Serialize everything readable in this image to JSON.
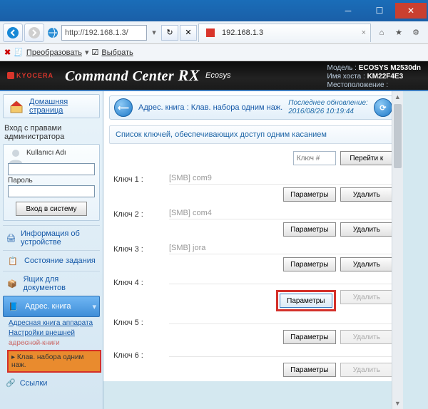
{
  "window": {
    "url": "http://192.168.1.3/",
    "tab_title": "192.168.1.3"
  },
  "linkbar": {
    "convert": "Преобразовать",
    "select": "Выбрать"
  },
  "header": {
    "brand_small": "KYOCERA",
    "title": "Command Center",
    "title_rx": "RX",
    "ecosys": "Ecosys",
    "model_lbl": "Модель :",
    "model": "ECOSYS M2530dn",
    "host_lbl": "Имя хоста :",
    "host": "KM22F4E3",
    "loc_lbl": "Местоположение :",
    "loc": ""
  },
  "sidebar": {
    "home": "Домашняя страница",
    "admin_head": "Вход с правами администратора",
    "user_lbl": "Kullanıcı Adı",
    "pass_lbl": "Пароль",
    "login_btn": "Вход в систему",
    "items": [
      "Информация об устройстве",
      "Состояние задания",
      "Ящик для документов",
      "Адрес. книга"
    ],
    "sub": {
      "a": "Адресная книга аппарата",
      "b": "Настройки внешней",
      "b2": "адресной книги",
      "current": "Клав. набора одним наж."
    },
    "refs": "Ссылки"
  },
  "crumb": {
    "text": "Адрес. книга : Клав. набора одним наж.",
    "upd1": "Последнее обновление:",
    "upd2": "2016/08/26 10:19:44"
  },
  "main": {
    "section": "Список ключей, обеспечивающих доступ одним касанием",
    "key_placeholder": "Ключ #",
    "goto": "Перейти к",
    "key_lbl": "Ключ",
    "params": "Параметры",
    "delete": "Удалить",
    "rows": [
      {
        "n": "1",
        "val": "[SMB] com9",
        "del": true
      },
      {
        "n": "2",
        "val": "[SMB] com4",
        "del": true
      },
      {
        "n": "3",
        "val": "[SMB] jora",
        "del": true
      },
      {
        "n": "4",
        "val": "",
        "del": false,
        "highlight": true
      },
      {
        "n": "5",
        "val": "",
        "del": false
      },
      {
        "n": "6",
        "val": "",
        "del": false
      }
    ]
  }
}
